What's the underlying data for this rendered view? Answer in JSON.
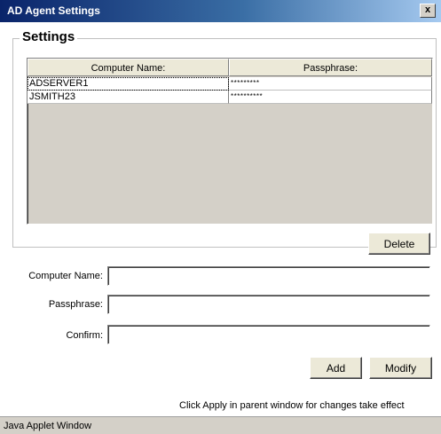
{
  "window": {
    "title": "AD Agent Settings",
    "close_label": "x",
    "footer": "Java Applet Window"
  },
  "settings": {
    "group_label": "Settings",
    "table": {
      "columns": [
        "Computer Name:",
        "Passphrase:"
      ],
      "rows": [
        {
          "computer": "ADSERVER1",
          "passphrase": "*********"
        },
        {
          "computer": "JSMITH23",
          "passphrase": "**********"
        }
      ]
    },
    "delete_label": "Delete"
  },
  "form": {
    "computer_name_label": "Computer Name:",
    "passphrase_label": "Passphrase:",
    "confirm_label": "Confirm:",
    "computer_name_value": "",
    "passphrase_value": "",
    "confirm_value": "",
    "add_label": "Add",
    "modify_label": "Modify"
  },
  "status": {
    "message": "Click Apply in parent window for changes take effect"
  }
}
